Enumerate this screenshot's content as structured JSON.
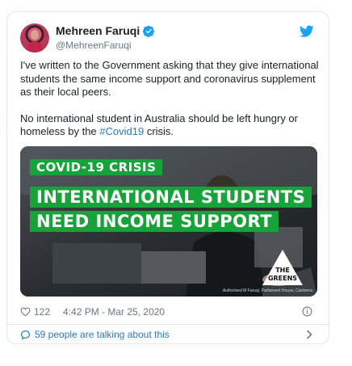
{
  "author": {
    "display_name": "Mehreen Faruqi",
    "handle": "@MehreenFaruqi"
  },
  "tweet": {
    "paragraph1": "I've written to the Government asking that they give international students the same income support and coronavirus supplement as their local peers.",
    "paragraph2_prefix": "No international student in Australia should be left hungry or homeless by the ",
    "hashtag": "#Covid19",
    "paragraph2_suffix": " crisis."
  },
  "media": {
    "banner_crisis": "COVID-19 CRISIS",
    "banner_line1": "INTERNATIONAL STUDENTS",
    "banner_line2": "NEED INCOME SUPPORT",
    "logo_line1": "THE",
    "logo_line2": "GREENS",
    "authorised": "Authorised M Faruqi, Parliament House, Canberra"
  },
  "meta": {
    "likes": "122",
    "timestamp": "4:42 PM - Mar 25, 2020"
  },
  "conversation": {
    "label": "59 people are talking about this"
  },
  "colors": {
    "accent": "#2b7bb9",
    "greens_green": "#18a33a",
    "border": "#e1e8ed",
    "muted": "#697882"
  },
  "icons": [
    "avatar",
    "verified-icon",
    "twitter-bird-icon",
    "heart-icon",
    "info-icon",
    "speech-bubble-icon",
    "chevron-right-icon"
  ]
}
